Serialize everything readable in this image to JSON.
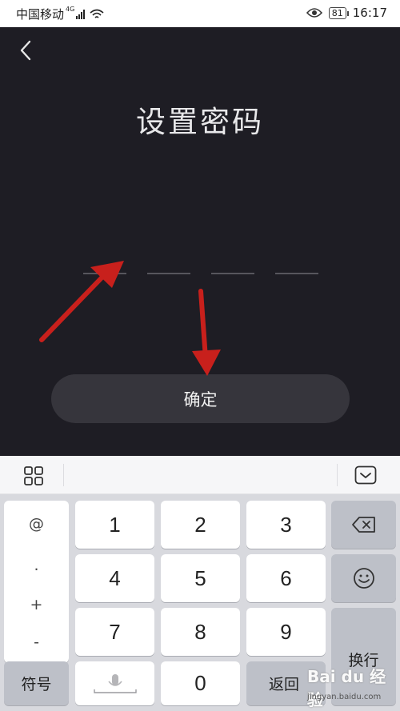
{
  "status_bar": {
    "carrier": "中国移动",
    "network": "4G",
    "battery": "81",
    "time": "16:17"
  },
  "screen": {
    "title": "设置密码",
    "pin_length": 4,
    "confirm_label": "确定"
  },
  "annotation": {
    "arrow_color": "#c8201c"
  },
  "keyboard": {
    "symbols": [
      "@",
      ".",
      "+",
      "-"
    ],
    "digits": [
      "1",
      "2",
      "3",
      "4",
      "5",
      "6",
      "7",
      "8",
      "9",
      "0"
    ],
    "enter_label": "换行",
    "symbol_label": "符号",
    "return_label": "返回"
  },
  "watermark": {
    "text": "Bai du 经验",
    "url": "jingyan.baidu.com"
  }
}
